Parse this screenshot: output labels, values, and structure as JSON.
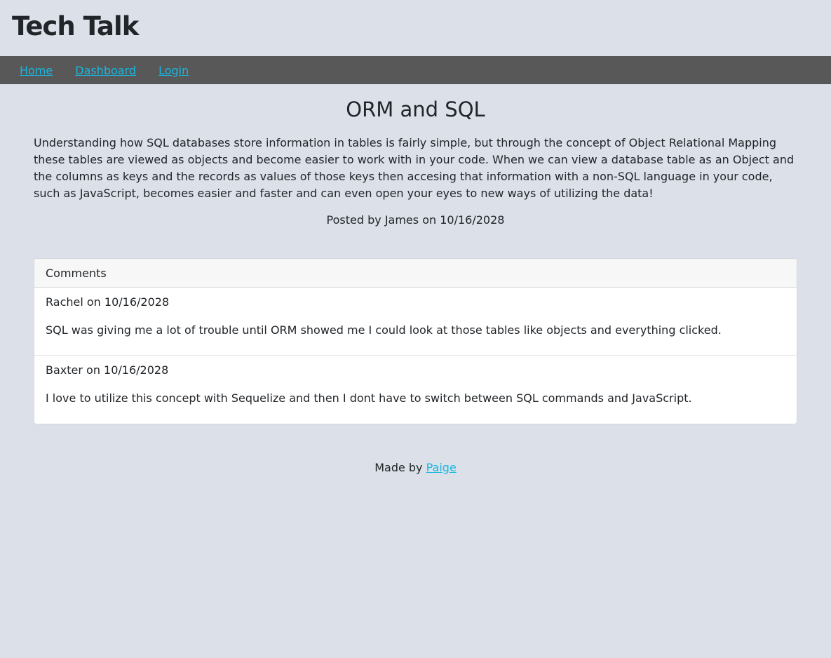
{
  "header": {
    "site_title": "Tech Talk"
  },
  "nav": {
    "items": [
      {
        "label": "Home"
      },
      {
        "label": "Dashboard"
      },
      {
        "label": "Login"
      }
    ]
  },
  "post": {
    "title": "ORM and SQL",
    "body": "Understanding how SQL databases store information in tables is fairly simple, but through the concept of Object Relational Mapping these tables are viewed as objects and become easier to work with in your code. When we can view a database table as an Object and the columns as keys and the records as values of those keys then accesing that information with a non-SQL language in your code, such as JavaScript, becomes easier and faster and can even open your eyes to new ways of utilizing the data!",
    "meta": "Posted by James on 10/16/2028"
  },
  "comments": {
    "header": "Comments",
    "items": [
      {
        "meta": "Rachel on 10/16/2028",
        "text": "SQL was giving me a lot of trouble until ORM showed me I could look at those tables like objects and everything clicked."
      },
      {
        "meta": "Baxter on 10/16/2028",
        "text": "I love to utilize this concept with Sequelize and then I dont have to switch between SQL commands and JavaScript."
      }
    ]
  },
  "footer": {
    "prefix": "Made by ",
    "author_link": "Paige"
  },
  "colors": {
    "background": "#dce1e9",
    "navbar": "#585858",
    "link": "#18b7e0",
    "card_header": "#f7f7f7"
  }
}
